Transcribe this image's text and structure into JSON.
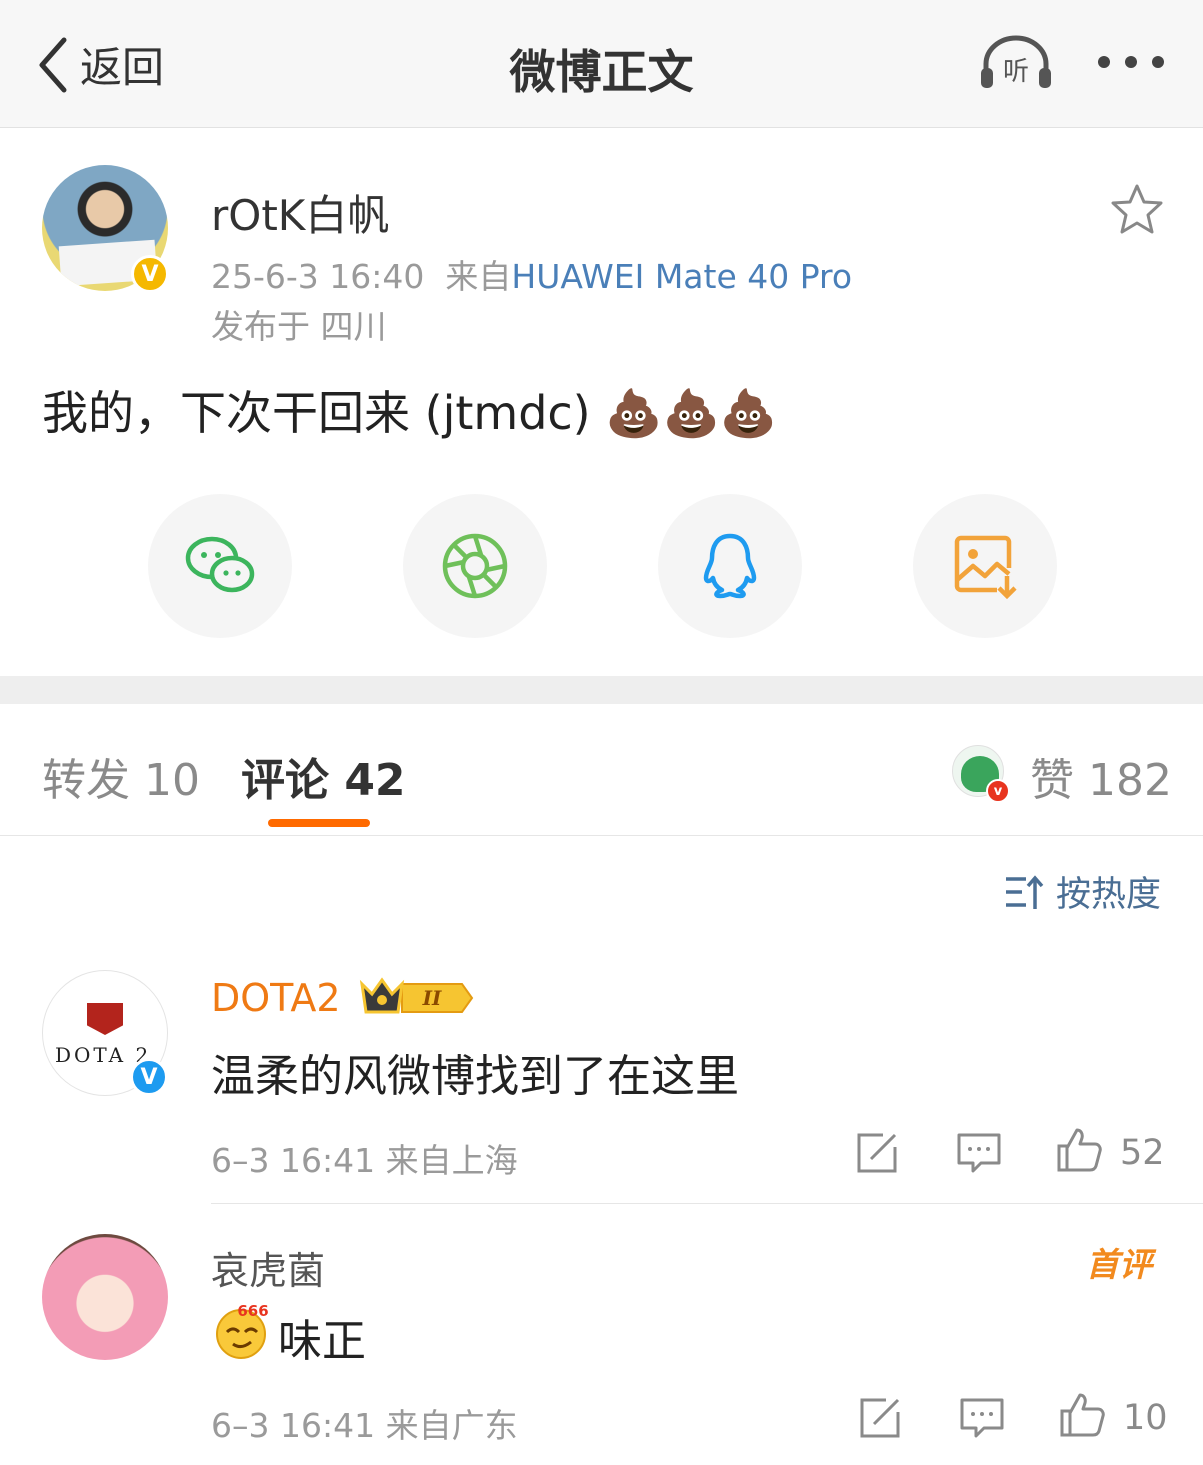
{
  "nav": {
    "back_label": "返回",
    "title": "微博正文",
    "listen_label": "听"
  },
  "post": {
    "username": "rOtK白帆",
    "time": "25-6-3 16:40",
    "source_prefix": "来自",
    "device": "HUAWEI Mate 40 Pro",
    "location": "发布于 四川",
    "text": "我的，下次干回来 (jtmdc)",
    "emoji": "💩💩💩"
  },
  "share": [
    {
      "name": "wechat",
      "color": "#3cb55d"
    },
    {
      "name": "moments",
      "color": "#6fc05a"
    },
    {
      "name": "qq",
      "color": "#1e9bf0"
    },
    {
      "name": "save-image",
      "color": "#f2a33a"
    }
  ],
  "tabs": {
    "repost": "转发 10",
    "comment": "评论 42",
    "like": "赞 182"
  },
  "sort_label": "按热度",
  "comments": [
    {
      "name": "DOTA2",
      "avatar_text": "DOTA 2",
      "level_badge": "II",
      "text": "温柔的风微博找到了在这里",
      "meta": "6–3 16:41 来自上海",
      "likes": "52"
    },
    {
      "name": "哀虎菌",
      "first_badge": "首评",
      "emoji_label": "666",
      "text": "味正",
      "meta": "6–3 16:41 来自广东",
      "likes": "10"
    }
  ],
  "colors": {
    "accent_orange": "#ff6a00",
    "link_blue": "#4a7fb8",
    "vip_gold": "#f5b800"
  }
}
